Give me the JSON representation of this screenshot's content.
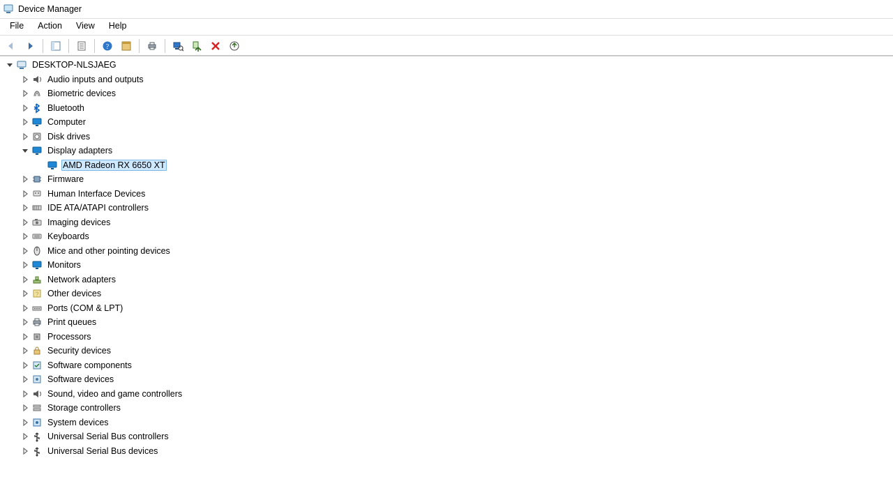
{
  "window": {
    "title": "Device Manager"
  },
  "menu": {
    "file": "File",
    "action": "Action",
    "view": "View",
    "help": "Help"
  },
  "toolbar_icons": {
    "back": "back-arrow",
    "forward": "forward-arrow",
    "show_hide": "show-hide-console-tree",
    "properties_sheet": "properties-sheet",
    "help": "help",
    "action_block": "action-block",
    "print": "print",
    "scan": "scan-hardware",
    "enable": "enable-device",
    "disable": "disable-device",
    "update": "update-driver"
  },
  "tree": {
    "root": {
      "label": "DESKTOP-NLSJAEG",
      "expanded": true,
      "icon": "computer"
    },
    "categories": [
      {
        "label": "Audio inputs and outputs",
        "icon": "audio",
        "expanded": false
      },
      {
        "label": "Biometric devices",
        "icon": "biometric",
        "expanded": false
      },
      {
        "label": "Bluetooth",
        "icon": "bluetooth",
        "expanded": false
      },
      {
        "label": "Computer",
        "icon": "monitor",
        "expanded": false
      },
      {
        "label": "Disk drives",
        "icon": "disk",
        "expanded": false
      },
      {
        "label": "Display adapters",
        "icon": "monitor",
        "expanded": true,
        "children": [
          {
            "label": "AMD Radeon RX 6650 XT",
            "icon": "monitor",
            "selected": true
          }
        ]
      },
      {
        "label": "Firmware",
        "icon": "chip",
        "expanded": false
      },
      {
        "label": "Human Interface Devices",
        "icon": "hid",
        "expanded": false
      },
      {
        "label": "IDE ATA/ATAPI controllers",
        "icon": "ide",
        "expanded": false
      },
      {
        "label": "Imaging devices",
        "icon": "imaging",
        "expanded": false
      },
      {
        "label": "Keyboards",
        "icon": "keyboard",
        "expanded": false
      },
      {
        "label": "Mice and other pointing devices",
        "icon": "mouse",
        "expanded": false
      },
      {
        "label": "Monitors",
        "icon": "monitor",
        "expanded": false
      },
      {
        "label": "Network adapters",
        "icon": "network",
        "expanded": false
      },
      {
        "label": "Other devices",
        "icon": "other",
        "expanded": false
      },
      {
        "label": "Ports (COM & LPT)",
        "icon": "port",
        "expanded": false
      },
      {
        "label": "Print queues",
        "icon": "printer",
        "expanded": false
      },
      {
        "label": "Processors",
        "icon": "cpu",
        "expanded": false
      },
      {
        "label": "Security devices",
        "icon": "security",
        "expanded": false
      },
      {
        "label": "Software components",
        "icon": "swcomp",
        "expanded": false
      },
      {
        "label": "Software devices",
        "icon": "swdev",
        "expanded": false
      },
      {
        "label": "Sound, video and game controllers",
        "icon": "audio",
        "expanded": false
      },
      {
        "label": "Storage controllers",
        "icon": "storage",
        "expanded": false
      },
      {
        "label": "System devices",
        "icon": "system",
        "expanded": false
      },
      {
        "label": "Universal Serial Bus controllers",
        "icon": "usb",
        "expanded": false
      },
      {
        "label": "Universal Serial Bus devices",
        "icon": "usb",
        "expanded": false
      }
    ]
  }
}
